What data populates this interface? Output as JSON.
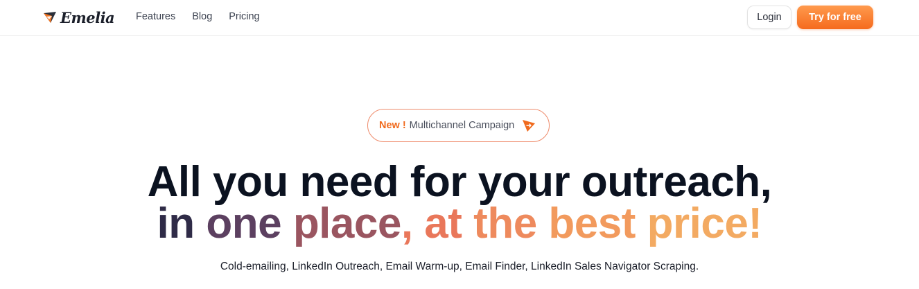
{
  "header": {
    "logo_text": "Emelia",
    "nav": [
      {
        "label": "Features"
      },
      {
        "label": "Blog"
      },
      {
        "label": "Pricing"
      }
    ],
    "login_label": "Login",
    "cta_label": "Try for free"
  },
  "hero": {
    "badge": {
      "new_label": "New !",
      "text": "Multichannel Campaign",
      "icon": "paper-plane-icon"
    },
    "headline_line1": "All you need for your outreach,",
    "headline_line2": {
      "w1": "in ",
      "w2": "one ",
      "w3": "place",
      "w4": ", at ",
      "w5": "the ",
      "w6": "best ",
      "w7": "price!"
    },
    "subtitle": "Cold-emailing, LinkedIn Outreach, Email Warm-up, Email Finder, LinkedIn Sales Navigator Scraping."
  },
  "colors": {
    "accent": "#f56b1e",
    "headline": "#0b1220",
    "gradient_start": "#2f2b47",
    "gradient_end": "#f3aa62"
  }
}
